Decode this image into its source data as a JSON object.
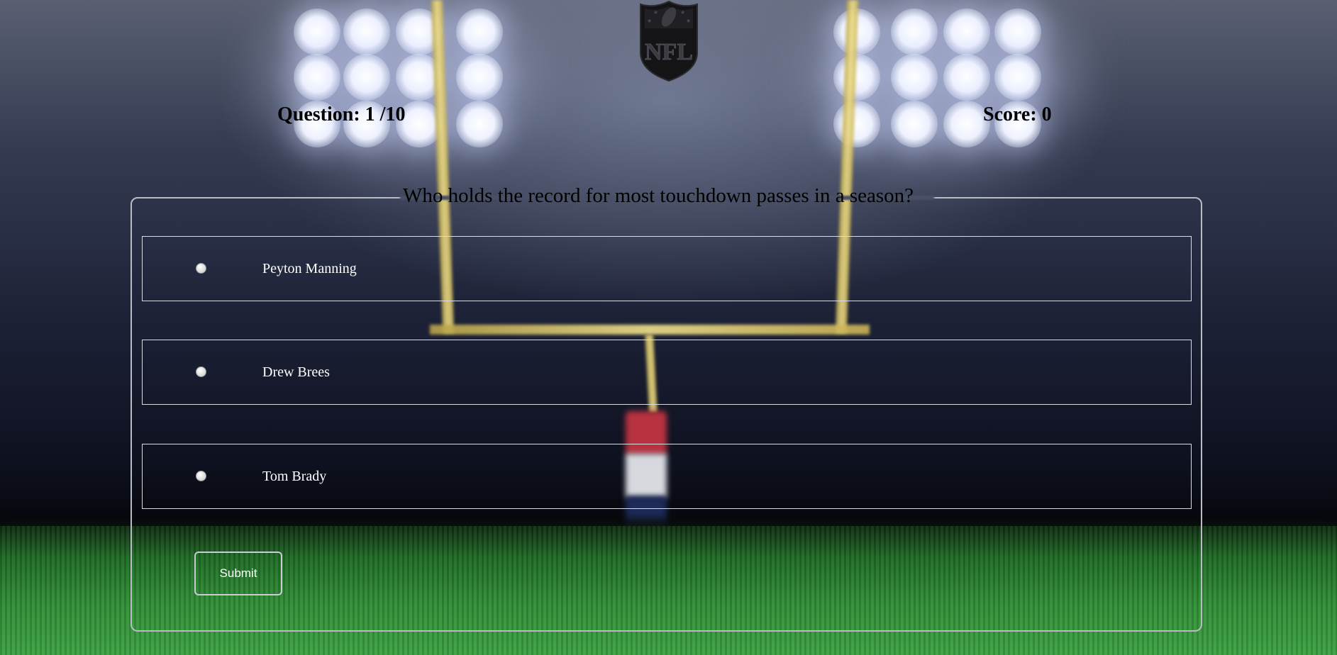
{
  "header": {
    "logo_icon": "nfl-shield-icon",
    "logo_text": "NFL",
    "question_label": "Question: 1 /10",
    "score_label": "Score: 0"
  },
  "quiz": {
    "question": "Who holds the record for most touchdown passes in a season?",
    "options": [
      {
        "label": "Peyton Manning",
        "selected": false
      },
      {
        "label": "Drew Brees",
        "selected": false
      },
      {
        "label": "Tom Brady",
        "selected": false
      }
    ],
    "submit_label": "Submit"
  },
  "colors": {
    "text_dark": "#000000",
    "text_light": "#ffffff",
    "option_border": "#d9dce2",
    "fieldset_border": "#b8bcc4"
  }
}
